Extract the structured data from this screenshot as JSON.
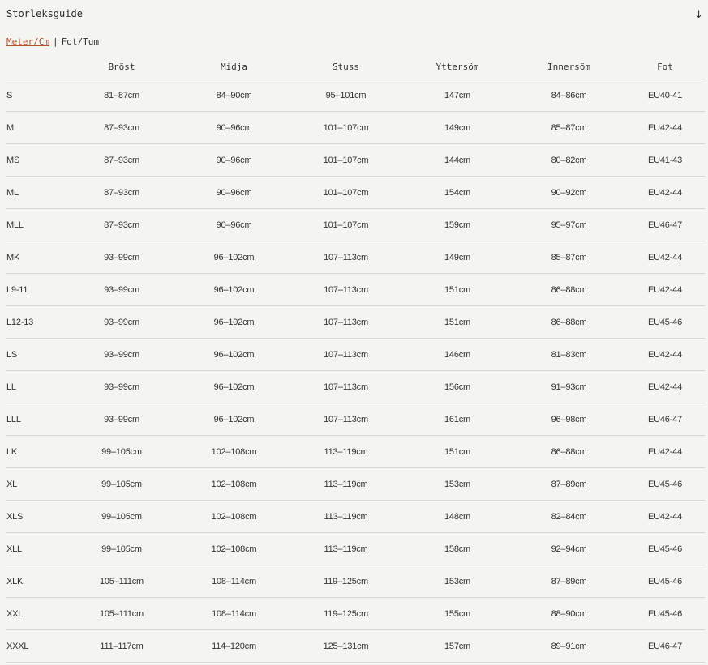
{
  "header": {
    "title": "Storleksguide",
    "toggle_icon": "arrow-down-icon"
  },
  "units": {
    "active": "Meter/Cm",
    "separator": "|",
    "inactive": "Fot/Tum"
  },
  "table": {
    "columns": [
      "",
      "Bröst",
      "Midja",
      "Stuss",
      "Yttersöm",
      "Innersöm",
      "Fot"
    ],
    "rows": [
      [
        "S",
        "81–87cm",
        "84–90cm",
        "95–101cm",
        "147cm",
        "84–86cm",
        "EU40-41"
      ],
      [
        "M",
        "87–93cm",
        "90–96cm",
        "101–107cm",
        "149cm",
        "85–87cm",
        "EU42-44"
      ],
      [
        "MS",
        "87–93cm",
        "90–96cm",
        "101–107cm",
        "144cm",
        "80–82cm",
        "EU41-43"
      ],
      [
        "ML",
        "87–93cm",
        "90–96cm",
        "101–107cm",
        "154cm",
        "90–92cm",
        "EU42-44"
      ],
      [
        "MLL",
        "87–93cm",
        "90–96cm",
        "101–107cm",
        "159cm",
        "95–97cm",
        "EU46-47"
      ],
      [
        "MK",
        "93–99cm",
        "96–102cm",
        "107–113cm",
        "149cm",
        "85–87cm",
        "EU42-44"
      ],
      [
        "L9-11",
        "93–99cm",
        "96–102cm",
        "107–113cm",
        "151cm",
        "86–88cm",
        "EU42-44"
      ],
      [
        "L12-13",
        "93–99cm",
        "96–102cm",
        "107–113cm",
        "151cm",
        "86–88cm",
        "EU45-46"
      ],
      [
        "LS",
        "93–99cm",
        "96–102cm",
        "107–113cm",
        "146cm",
        "81–83cm",
        "EU42-44"
      ],
      [
        "LL",
        "93–99cm",
        "96–102cm",
        "107–113cm",
        "156cm",
        "91–93cm",
        "EU42-44"
      ],
      [
        "LLL",
        "93–99cm",
        "96–102cm",
        "107–113cm",
        "161cm",
        "96–98cm",
        "EU46-47"
      ],
      [
        "LK",
        "99–105cm",
        "102–108cm",
        "113–119cm",
        "151cm",
        "86–88cm",
        "EU42-44"
      ],
      [
        "XL",
        "99–105cm",
        "102–108cm",
        "113–119cm",
        "153cm",
        "87–89cm",
        "EU45-46"
      ],
      [
        "XLS",
        "99–105cm",
        "102–108cm",
        "113–119cm",
        "148cm",
        "82–84cm",
        "EU42-44"
      ],
      [
        "XLL",
        "99–105cm",
        "102–108cm",
        "113–119cm",
        "158cm",
        "92–94cm",
        "EU45-46"
      ],
      [
        "XLK",
        "105–111cm",
        "108–114cm",
        "119–125cm",
        "153cm",
        "87–89cm",
        "EU45-46"
      ],
      [
        "XXL",
        "105–111cm",
        "108–114cm",
        "119–125cm",
        "155cm",
        "88–90cm",
        "EU45-46"
      ],
      [
        "XXXL",
        "111–117cm",
        "114–120cm",
        "125–131cm",
        "157cm",
        "89–91cm",
        "EU46-47"
      ]
    ]
  },
  "colors": {
    "accent": "#b5542b",
    "background": "#f4f4f1",
    "text": "#2a2a2a",
    "divider": "#d6d6d2"
  }
}
